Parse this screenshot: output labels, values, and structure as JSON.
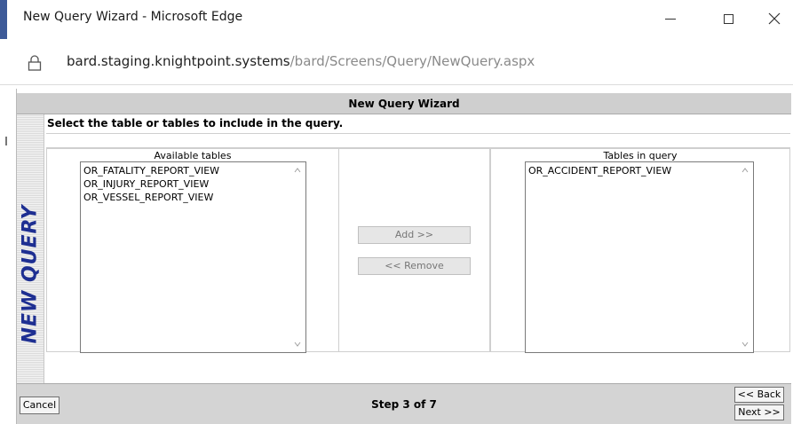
{
  "window": {
    "title": "New Query Wizard - Microsoft Edge"
  },
  "address": {
    "host": "bard.staging.knightpoint.systems",
    "path": "/bard/Screens/Query/NewQuery.aspx"
  },
  "wizard": {
    "header": "New Query Wizard",
    "side_label": "NEW QUERY",
    "instruction": "Select the table or tables to include in the query.",
    "available": {
      "caption": "Available tables",
      "items": [
        "OR_FATALITY_REPORT_VIEW",
        "OR_INJURY_REPORT_VIEW",
        "OR_VESSEL_REPORT_VIEW"
      ]
    },
    "selected": {
      "caption": "Tables in query",
      "items": [
        "OR_ACCIDENT_REPORT_VIEW"
      ]
    },
    "add_label": "Add >>",
    "remove_label": "<< Remove",
    "cancel_label": "Cancel",
    "step_label": "Step 3 of 7",
    "back_label": "<< Back",
    "next_label": "Next >>"
  },
  "icons": {
    "lock": "lock-icon",
    "minimize": "minimize-icon",
    "maximize": "maximize-icon",
    "close": "close-icon"
  }
}
